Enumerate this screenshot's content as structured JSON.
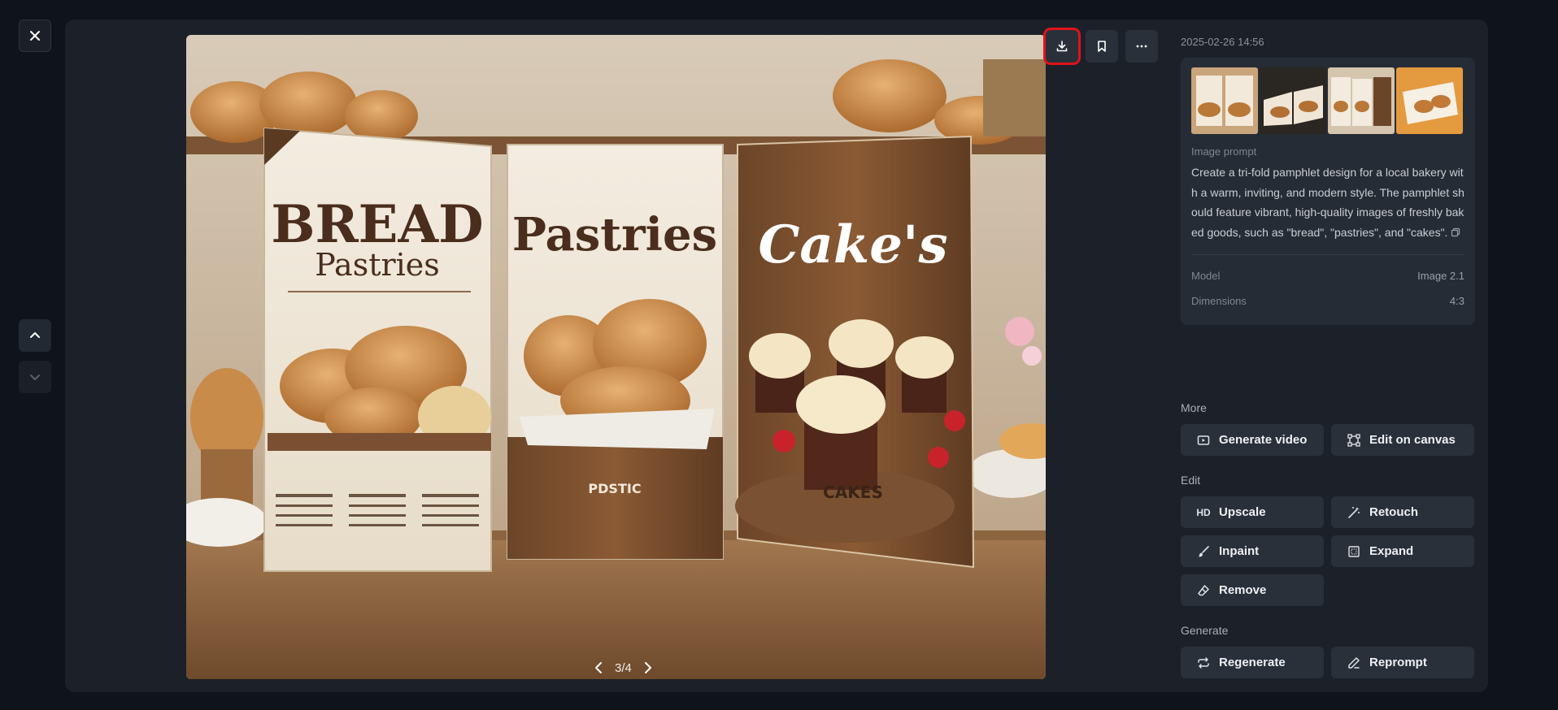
{
  "nav": {
    "close_icon": "close-icon",
    "prev_icon": "chevron-up-icon",
    "next_icon": "chevron-down-icon"
  },
  "image": {
    "pager": "3/4",
    "panel_texts": {
      "left_title": "BREAD",
      "left_subtitle": "Pastries",
      "middle_title": "Pastries",
      "middle_footer": "PDSTIC",
      "right_title": "Cake's",
      "right_footer": "CAKES"
    }
  },
  "actions": {
    "download_icon": "download-icon",
    "bookmark_icon": "bookmark-icon",
    "more_icon": "more-horizontal-icon"
  },
  "details": {
    "timestamp": "2025-02-26 14:56",
    "prompt_label": "Image prompt",
    "prompt_text": "Create a tri-fold pamphlet design for a local bakery with a warm, inviting, and modern style. The pamphlet should feature vibrant, high-quality images of freshly baked goods, such as \"bread\", \"pastries\", and \"cakes\".",
    "model_label": "Model",
    "model_value": "Image 2.1",
    "dimensions_label": "Dimensions",
    "dimensions_value": "4:3"
  },
  "sections": {
    "more": "More",
    "edit": "Edit",
    "generate": "Generate"
  },
  "buttons": {
    "generate_video": "Generate video",
    "edit_on_canvas": "Edit on canvas",
    "upscale": "Upscale",
    "upscale_icon_text": "HD",
    "retouch": "Retouch",
    "inpaint": "Inpaint",
    "expand": "Expand",
    "remove": "Remove",
    "regenerate": "Regenerate",
    "reprompt": "Reprompt"
  },
  "colors": {
    "background": "#0f131a",
    "panel": "#1c2129",
    "button": "#2a3039",
    "highlight": "#e0131a"
  }
}
